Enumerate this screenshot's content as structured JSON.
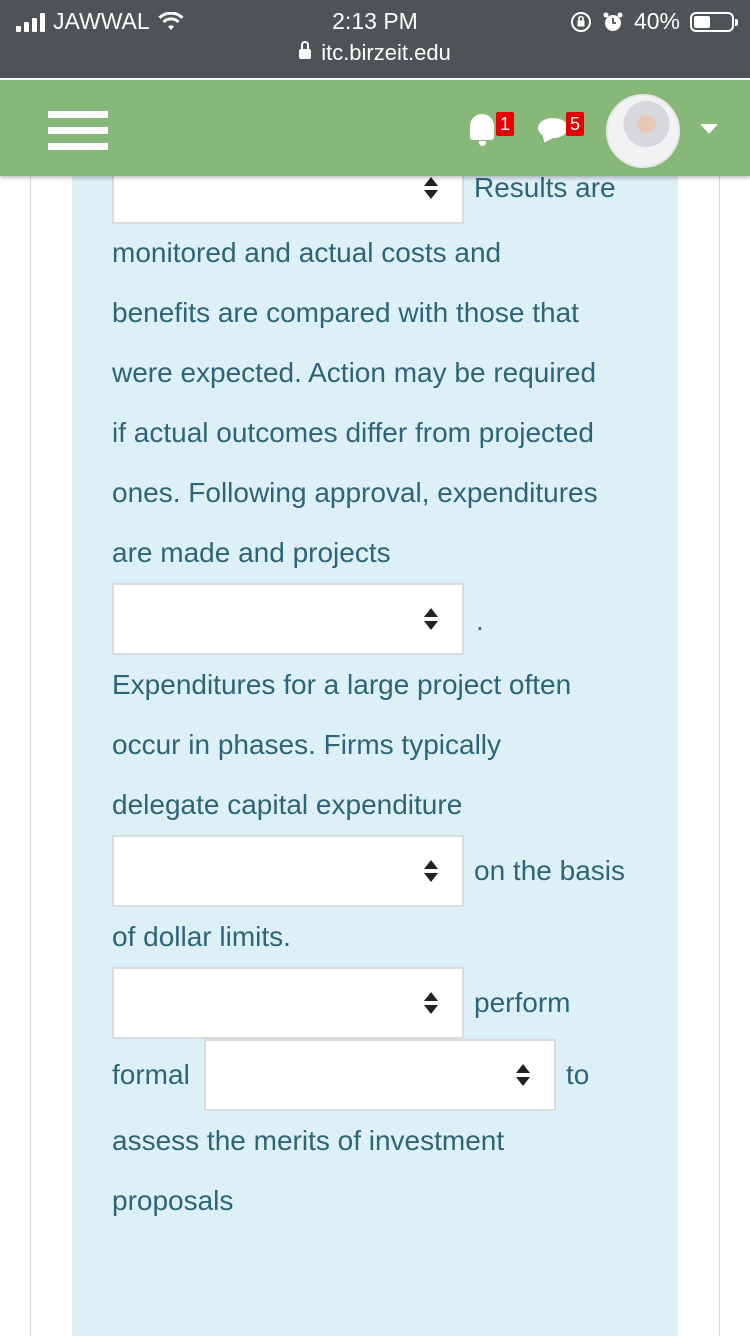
{
  "status_bar": {
    "carrier": "JAWWAL",
    "time": "2:13 PM",
    "battery": "40%",
    "battery_level": 0.4,
    "url": "itc.birzeit.edu"
  },
  "navbar": {
    "notifications_count": "1",
    "messages_count": "5",
    "colors": {
      "bar": "#87b87a",
      "badge": "#e60000"
    }
  },
  "question": {
    "lines": {
      "l1": "Results are",
      "l2": "monitored and actual costs and",
      "l3": "benefits are compared with those that",
      "l4": "were expected. Action may be required",
      "l5": "if actual outcomes differ from projected",
      "l6": "ones. Following approval, expenditures",
      "l7": "are made and projects",
      "l8": ".",
      "l9": "Expenditures for a large project often",
      "l10": "occur in phases. Firms typically",
      "l11": "delegate capital expenditure",
      "l12": "on the basis",
      "l13": "of dollar limits.",
      "l14": "perform",
      "l15": "formal",
      "l16": "to",
      "l17": "assess the merits of investment",
      "l18": "proposals"
    },
    "dropdowns": [
      "",
      "",
      "",
      "",
      ""
    ],
    "colors": {
      "panel": "#def0f7",
      "text": "#2d6477"
    }
  }
}
